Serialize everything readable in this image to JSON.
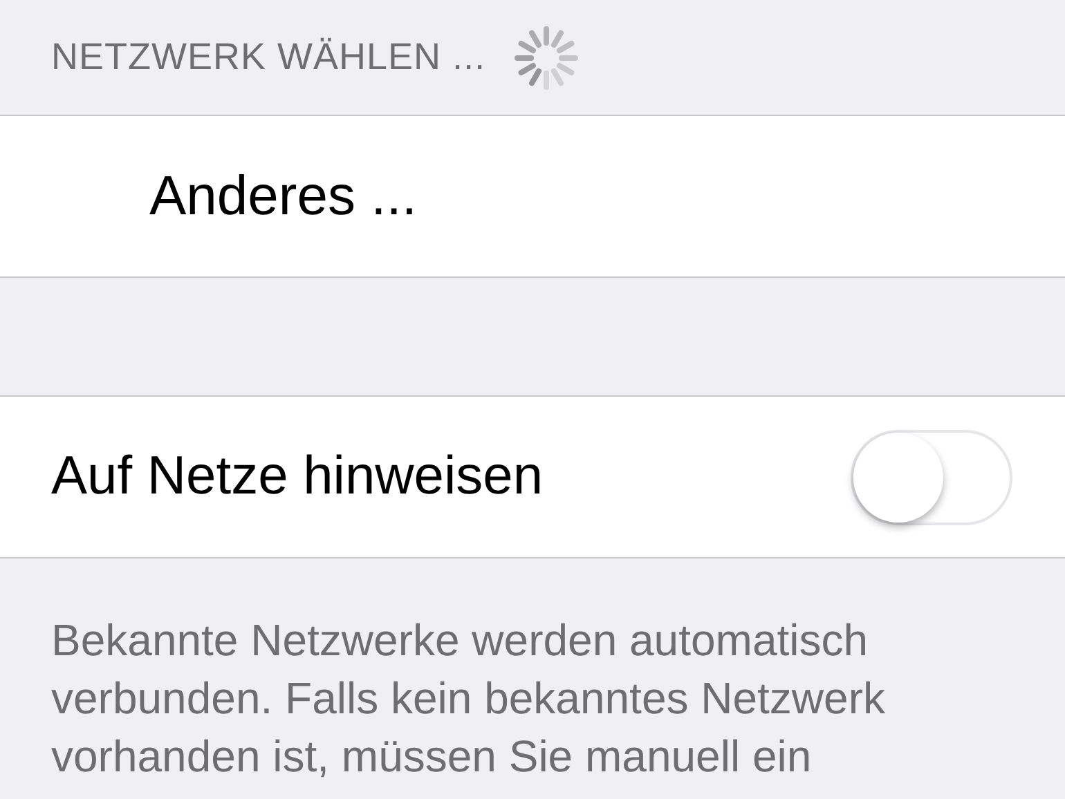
{
  "section_header": {
    "title": "NETZWERK WÄHLEN ...",
    "loading": true
  },
  "networks": [
    {
      "label": "Anderes ..."
    }
  ],
  "settings": [
    {
      "kind": "switch",
      "label": "Auf Netze hinweisen",
      "on": false
    }
  ],
  "footer": "Bekannte Netzwerke werden automatisch verbunden. Falls kein bekanntes Netzwerk vorhanden ist, müssen Sie manuell ein"
}
